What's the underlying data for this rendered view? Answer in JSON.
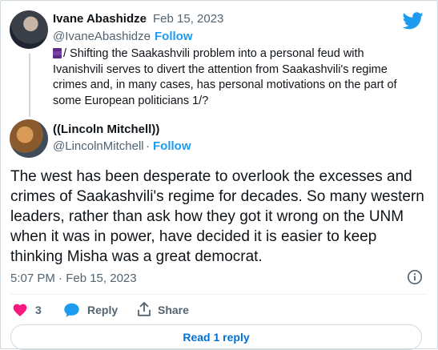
{
  "quoted_tweet": {
    "author_name": "Ivane Abashidze",
    "separator": "·",
    "date": "Feb 15, 2023",
    "handle": "@IvaneAbashidze",
    "follow_separator": "·",
    "follow_label": "Follow",
    "text": "/ Shifting the Saakashvili problem into a personal feud with Ivanishvili serves to divert the attention from Saakashvili's regime crimes and, in many cases, has personal motivations on the part of some European politicians 1/?"
  },
  "main_tweet": {
    "author_name": "((Lincoln Mitchell))",
    "handle": "@LincolnMitchell",
    "follow_separator": "·",
    "follow_label": "Follow",
    "text": "The west has been desperate to overlook the excesses and crimes of Saakashvili's regime for decades. So many western leaders, rather than ask how they got it wrong on the UNM when it was in power, have decided it is easier to keep thinking Misha was a great democrat.",
    "timestamp": "5:07 PM · Feb 15, 2023"
  },
  "actions": {
    "like_count": "3",
    "reply_label": "Reply",
    "share_label": "Share",
    "read_replies_label": "Read 1 reply"
  },
  "icons": {
    "brand": "twitter-bird-icon",
    "like": "heart-icon",
    "reply": "speech-bubble-icon",
    "share": "share-icon",
    "info": "info-icon",
    "flag": "flag-emoji-icon"
  },
  "colors": {
    "accent": "#1d9bf0",
    "heart": "#f91880",
    "secondary_text": "#536471",
    "read_reply_text": "#006fd6"
  }
}
